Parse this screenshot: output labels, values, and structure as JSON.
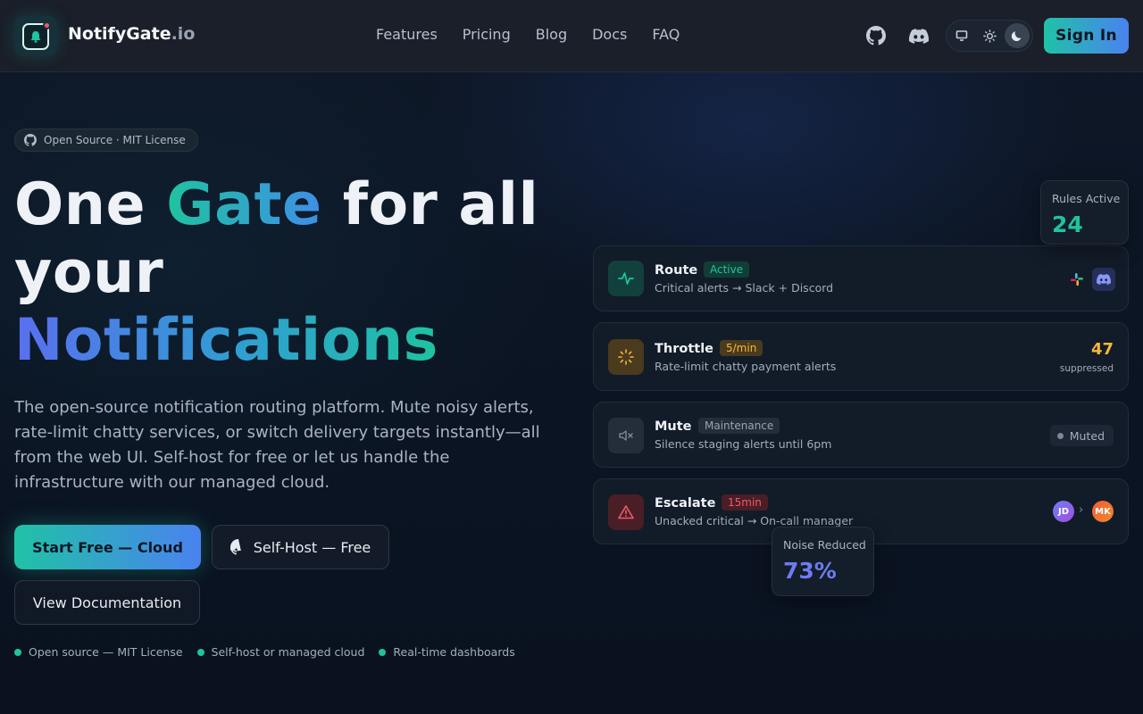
{
  "nav": {
    "brand_name": "NotifyGate",
    "brand_tld": ".io",
    "links": [
      "Features",
      "Pricing",
      "Blog",
      "Docs",
      "FAQ"
    ],
    "sign_in": "Sign In",
    "icons": [
      "github-icon",
      "discord-icon",
      "monitor-icon",
      "sun-icon",
      "moon-icon"
    ]
  },
  "hero": {
    "badge": "Open Source · MIT License",
    "headline": {
      "part1": "One ",
      "part2": "Gate",
      "part3": " for all your ",
      "part4": "Notifications"
    },
    "subtitle": "The open-source notification routing platform. Mute noisy alerts, rate-limit chatty services, or switch delivery targets instantly—all from the web UI. Self-host for free or let us handle the infrastructure with our managed cloud.",
    "primary_cta": "Start Free — Cloud",
    "secondary_cta": "Self-Host — Free",
    "docs_cta": "View Documentation",
    "bullets": [
      "Open source — MIT License",
      "Self-host or managed cloud",
      "Real-time dashboards"
    ]
  },
  "rules": [
    {
      "title": "Route",
      "tag": "Active",
      "desc": "Critical alerts → Slack + Discord"
    },
    {
      "title": "Throttle",
      "tag": "5/min",
      "desc": "Rate-limit chatty payment alerts",
      "stat": "47",
      "stat_label": "suppressed"
    },
    {
      "title": "Mute",
      "tag": "Maintenance",
      "desc": "Silence staging alerts until 6pm",
      "status": "Muted"
    },
    {
      "title": "Escalate",
      "tag": "15min",
      "desc": "Unacked critical → On-call manager",
      "avatars": [
        "JD",
        "MK"
      ]
    }
  ],
  "stats": {
    "rules_active_label": "Rules Active",
    "rules_active_value": "24",
    "noise_label": "Noise Reduced",
    "noise_value": "73%"
  },
  "colors": {
    "accent_teal": "#1fc3a0",
    "accent_blue": "#4a82f0",
    "throttle_amber": "#f5b83a",
    "escalate_red": "#f05a6a",
    "noise_indigo": "#6d7cf2"
  }
}
